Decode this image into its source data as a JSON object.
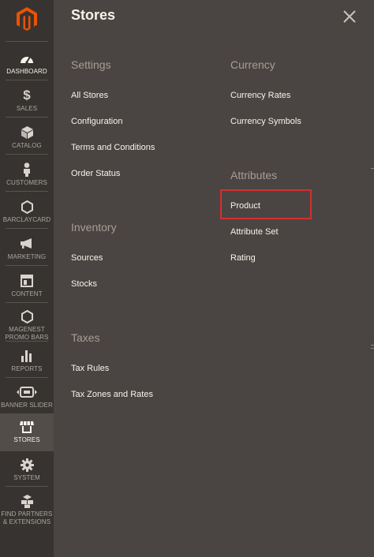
{
  "sidebar": {
    "items": [
      {
        "label": "DASHBOARD",
        "icon": "dashboard-gauge-icon"
      },
      {
        "label": "SALES",
        "icon": "dollar-icon"
      },
      {
        "label": "CATALOG",
        "icon": "cube-icon"
      },
      {
        "label": "CUSTOMERS",
        "icon": "person-icon"
      },
      {
        "label": "BARCLAYCARD",
        "icon": "hexagon-icon"
      },
      {
        "label": "MARKETING",
        "icon": "megaphone-icon"
      },
      {
        "label": "CONTENT",
        "icon": "layout-icon"
      },
      {
        "label": "MAGENEST\nPROMO BARS",
        "icon": "hexagon-icon"
      },
      {
        "label": "REPORTS",
        "icon": "bar-chart-icon"
      },
      {
        "label": "BANNER SLIDER",
        "icon": "slider-icon"
      },
      {
        "label": "STORES",
        "icon": "store-icon"
      },
      {
        "label": "SYSTEM",
        "icon": "gear-icon"
      },
      {
        "label": "FIND PARTNERS\n& EXTENSIONS",
        "icon": "boxes-icon"
      }
    ]
  },
  "panel": {
    "title": "Stores",
    "settings": {
      "title": "Settings",
      "links": [
        "All Stores",
        "Configuration",
        "Terms and Conditions",
        "Order Status"
      ]
    },
    "inventory": {
      "title": "Inventory",
      "links": [
        "Sources",
        "Stocks"
      ]
    },
    "taxes": {
      "title": "Taxes",
      "links": [
        "Tax Rules",
        "Tax Zones and Rates"
      ]
    },
    "currency": {
      "title": "Currency",
      "links": [
        "Currency Rates",
        "Currency Symbols"
      ]
    },
    "attributes": {
      "title": "Attributes",
      "links": [
        "Product",
        "Attribute Set",
        "Rating"
      ]
    }
  },
  "colors": {
    "sidebar_bg": "#373330",
    "panel_bg": "#4a4542",
    "active_bg": "#524d49",
    "logo_orange": "#eb5202",
    "highlight_border": "#d32f2f"
  }
}
